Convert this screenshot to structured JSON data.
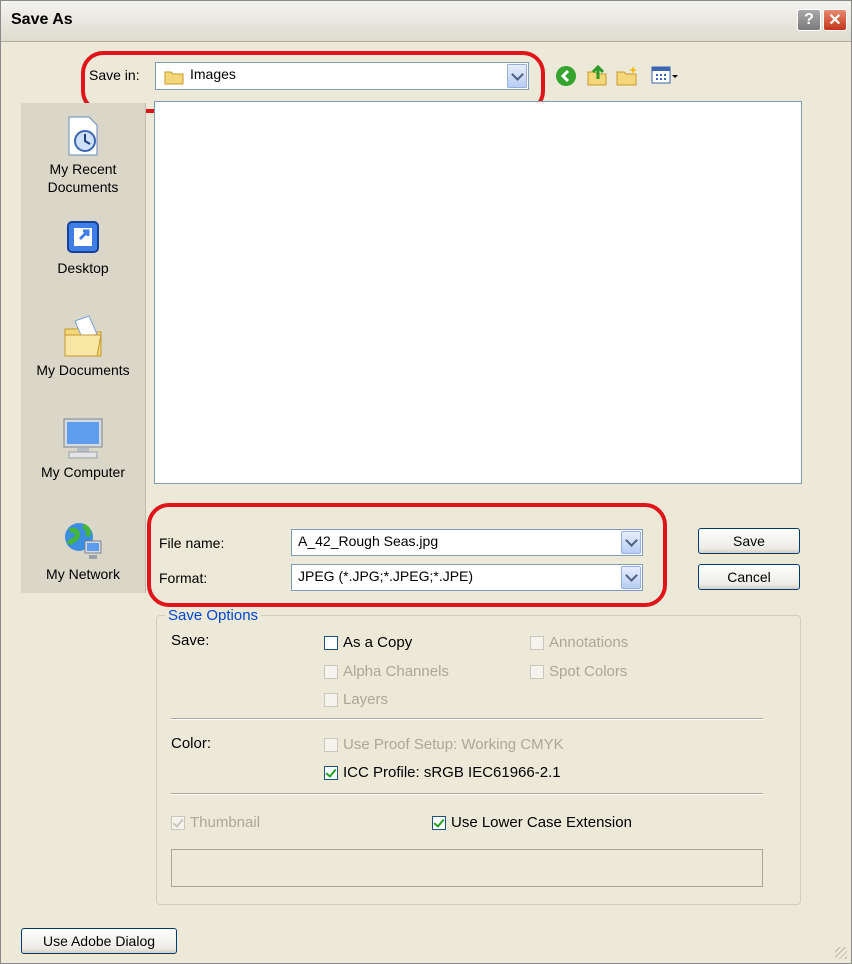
{
  "window": {
    "title": "Save As",
    "help_label": "?",
    "close_label": "✕"
  },
  "save_in": {
    "label": "Save in:",
    "value": "Images",
    "toolbar": [
      "back-icon",
      "up-folder-icon",
      "new-folder-icon",
      "view-menu-icon"
    ]
  },
  "places": [
    {
      "label": "My Recent\nDocuments",
      "icon": "recent-documents-icon"
    },
    {
      "label": "Desktop",
      "icon": "desktop-icon"
    },
    {
      "label": "My Documents",
      "icon": "my-documents-icon"
    },
    {
      "label": "My Computer",
      "icon": "my-computer-icon"
    },
    {
      "label": "My Network",
      "icon": "my-network-icon"
    }
  ],
  "file_name": {
    "label": "File name:",
    "value": "A_42_Rough Seas.jpg"
  },
  "format": {
    "label": "Format:",
    "value": "JPEG (*.JPG;*.JPEG;*.JPE)"
  },
  "buttons": {
    "save": "Save",
    "cancel": "Cancel",
    "adobe": "Use Adobe Dialog"
  },
  "options": {
    "title": "Save Options",
    "save_label": "Save:",
    "as_copy": "As a Copy",
    "annotations": "Annotations",
    "alpha_channels": "Alpha Channels",
    "spot_colors": "Spot Colors",
    "layers": "Layers",
    "color_label": "Color:",
    "proof_setup": "Use Proof Setup:  Working CMYK",
    "icc_profile": "ICC Profile:  sRGB IEC61966-2.1",
    "thumbnail": "Thumbnail",
    "lower_case": "Use Lower Case Extension"
  },
  "colors": {
    "highlight_ring": "#e0141a",
    "dialog_bg": "#ece9d8",
    "link_blue": "#0046d5"
  }
}
